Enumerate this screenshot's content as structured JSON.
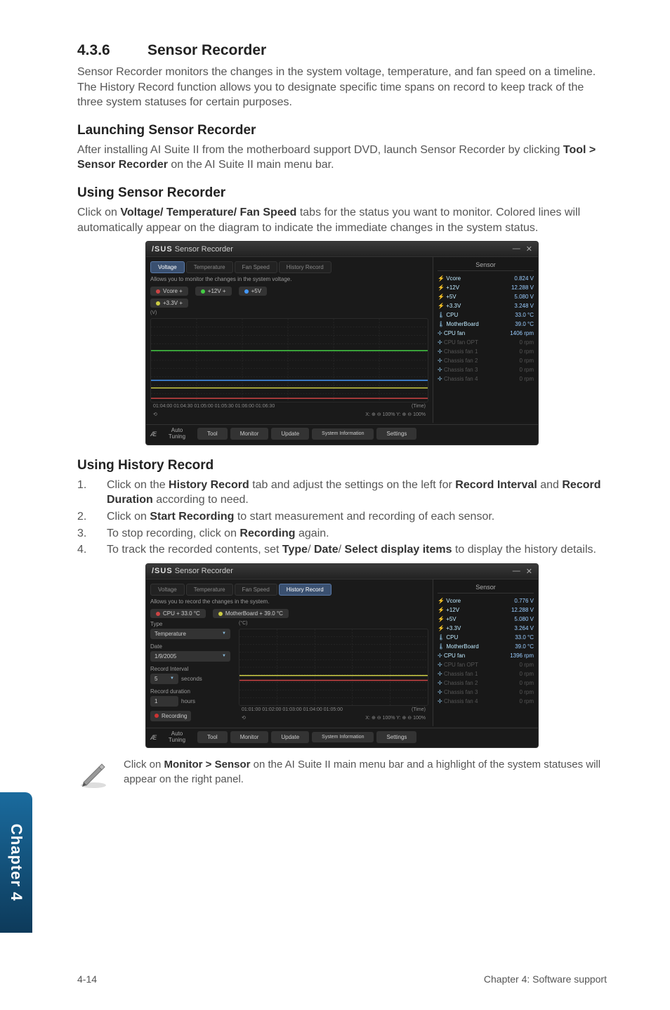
{
  "section": {
    "number": "4.3.6",
    "title": "Sensor Recorder",
    "intro": "Sensor Recorder monitors the changes in the system voltage, temperature, and fan speed on a timeline. The History Record function allows you to designate specific time spans on record to keep track of the three system statuses for certain purposes."
  },
  "launching": {
    "heading": "Launching Sensor Recorder",
    "text_before": "After installing AI Suite II from the motherboard support DVD, launch Sensor Recorder by clicking ",
    "bold": "Tool > Sensor Recorder",
    "text_after": " on the AI Suite II main menu bar."
  },
  "using": {
    "heading": "Using Sensor Recorder",
    "text_before": "Click on ",
    "bold": "Voltage/ Temperature/ Fan Speed",
    "text_after": " tabs for the status you want to monitor. Colored lines will automatically appear on the diagram to indicate the immediate changes in the system status."
  },
  "history_section": {
    "heading": "Using History Record",
    "items": [
      {
        "n": "1.",
        "before": "Click on the ",
        "b1": "History Record",
        "mid": " tab and adjust the settings on the left for ",
        "b2": "Record Interval",
        "mid2": " and ",
        "b3": "Record Duration",
        "after": " according to need."
      },
      {
        "n": "2.",
        "before": "Click on ",
        "b1": "Start Recording",
        "after": " to start measurement and recording of each sensor."
      },
      {
        "n": "3.",
        "before": "To stop recording, click on ",
        "b1": "Recording",
        "after": " again."
      },
      {
        "n": "4.",
        "before": "To track the recorded contents, set ",
        "b1": "Type",
        "mid": "/ ",
        "b2": "Date",
        "mid2": "/ ",
        "b3": "Select display items",
        "after": " to display the history details."
      }
    ]
  },
  "note": {
    "before": "Click on ",
    "bold": "Monitor > Sensor",
    "after": " on the AI Suite II main menu bar and a highlight of the system statuses will appear on the right panel."
  },
  "sidebar_label": "Chapter 4",
  "footer": {
    "left": "4-14",
    "right": "Chapter 4: Software support"
  },
  "app_common": {
    "brand": "/SUS",
    "title": "Sensor Recorder",
    "tabs": {
      "voltage": "Voltage",
      "temperature": "Temperature",
      "fan": "Fan Speed",
      "history": "History Record"
    },
    "sensor_panel_title": "Sensor",
    "bottombar": {
      "auto1": "Auto",
      "auto2": "Tuning",
      "tool": "Tool",
      "monitor": "Monitor",
      "update": "Update",
      "sysinfo": "System Information",
      "settings": "Settings"
    }
  },
  "voltage_screen": {
    "helper": "Allows you to monitor the changes in the system voltage.",
    "chips": [
      {
        "label": "Vcore +",
        "color": "#c44"
      },
      {
        "label": "+12V +",
        "color": "#4c4"
      },
      {
        "label": "+5V",
        "color": "#49f"
      },
      {
        "label": "+3.3V +",
        "color": "#cc4"
      }
    ],
    "y_unit": "(V)",
    "axis_scale": "X: ⊕ ⊖ 100%   Y: ⊕ ⊖ 100%",
    "axis_time_label": "(Time)",
    "x_ticks": "01:04:00  01:04:30  01:05:00  01:05:30  01:06:00  01:06:30",
    "sensors": [
      {
        "label": "Vcore",
        "val": "0.824 V"
      },
      {
        "label": "+12V",
        "val": "12.288 V"
      },
      {
        "label": "+5V",
        "val": "5.080 V"
      },
      {
        "label": "+3.3V",
        "val": "3.248 V"
      }
    ],
    "temps": [
      {
        "label": "CPU",
        "val": "33.0 °C"
      },
      {
        "label": "MotherBoard",
        "val": "39.0 °C"
      }
    ],
    "fans": [
      {
        "label": "CPU fan",
        "val": "1406 rpm",
        "dim": false
      },
      {
        "label": "CPU fan OPT",
        "val": "0 rpm",
        "dim": true
      },
      {
        "label": "Chassis fan 1",
        "val": "0 rpm",
        "dim": true
      },
      {
        "label": "Chassis fan 2",
        "val": "0 rpm",
        "dim": true
      },
      {
        "label": "Chassis fan 3",
        "val": "0 rpm",
        "dim": true
      },
      {
        "label": "Chassis fan 4",
        "val": "0 rpm",
        "dim": true
      }
    ]
  },
  "history_screen": {
    "helper": "Allows you to record the changes in the system.",
    "cpu_chip": "CPU +",
    "cpu_val": "33.0 °C",
    "mb_chip": "MotherBoard +",
    "mb_val": "39.0 °C",
    "controls": {
      "type_label": "Type",
      "type_value": "Temperature",
      "date_label": "Date",
      "date_value": "1/9/2005",
      "interval_label": "Record Interval",
      "interval_value": "5",
      "interval_unit": "seconds",
      "duration_label": "Record duration",
      "duration_value": "1",
      "duration_unit": "hours",
      "recording": "Recording"
    },
    "y_unit": "(°C)",
    "axis_scale": "X: ⊕ ⊖ 100%   Y: ⊕ ⊖ 100%",
    "axis_time_label": "(Time)",
    "x_ticks": "01:01:00 01:02:00 01:03:00 01:04:00 01:05:00",
    "sensors": [
      {
        "label": "Vcore",
        "val": "0.776 V"
      },
      {
        "label": "+12V",
        "val": "12.288 V"
      },
      {
        "label": "+5V",
        "val": "5.080 V"
      },
      {
        "label": "+3.3V",
        "val": "3.264 V"
      }
    ],
    "temps": [
      {
        "label": "CPU",
        "val": "33.0 °C"
      },
      {
        "label": "MotherBoard",
        "val": "39.0 °C"
      }
    ],
    "fans": [
      {
        "label": "CPU fan",
        "val": "1396 rpm",
        "dim": false
      },
      {
        "label": "CPU fan OPT",
        "val": "0 rpm",
        "dim": true
      },
      {
        "label": "Chassis fan 1",
        "val": "0 rpm",
        "dim": true
      },
      {
        "label": "Chassis fan 2",
        "val": "0 rpm",
        "dim": true
      },
      {
        "label": "Chassis fan 3",
        "val": "0 rpm",
        "dim": true
      },
      {
        "label": "Chassis fan 4",
        "val": "0 rpm",
        "dim": true
      }
    ]
  },
  "chart_data": [
    {
      "type": "line",
      "title": "System Voltage",
      "xlabel": "Time",
      "ylabel": "V",
      "x": [
        "01:04:00",
        "01:04:30",
        "01:05:00",
        "01:05:30",
        "01:06:00",
        "01:06:30"
      ],
      "ylim": [
        0,
        20
      ],
      "y_ticks": [
        0,
        2,
        4,
        6,
        8,
        10,
        12,
        14,
        16,
        18,
        20
      ],
      "series": [
        {
          "name": "Vcore",
          "color": "#c44",
          "values": [
            0.8,
            0.8,
            0.8,
            0.8,
            0.8,
            0.8
          ]
        },
        {
          "name": "+12V",
          "color": "#4c4",
          "values": [
            12.3,
            12.3,
            12.3,
            12.3,
            12.3,
            12.3
          ]
        },
        {
          "name": "+5V",
          "color": "#49f",
          "values": [
            5.1,
            5.1,
            5.1,
            5.1,
            5.1,
            5.1
          ]
        },
        {
          "name": "+3.3V",
          "color": "#cc4",
          "values": [
            3.2,
            3.2,
            3.2,
            3.2,
            3.2,
            3.2
          ]
        }
      ]
    },
    {
      "type": "line",
      "title": "Temperature History",
      "xlabel": "Time",
      "ylabel": "°C",
      "x": [
        "01:01:00",
        "01:02:00",
        "01:03:00",
        "01:04:00",
        "01:05:00"
      ],
      "ylim": [
        0,
        100
      ],
      "y_ticks": [
        0,
        10,
        20,
        30,
        40,
        50,
        60,
        70,
        80,
        90,
        100
      ],
      "series": [
        {
          "name": "CPU",
          "color": "#c44",
          "values": [
            33,
            33,
            33,
            33,
            33
          ]
        },
        {
          "name": "MotherBoard",
          "color": "#cc4",
          "values": [
            39,
            39,
            39,
            39,
            39
          ]
        }
      ]
    }
  ]
}
